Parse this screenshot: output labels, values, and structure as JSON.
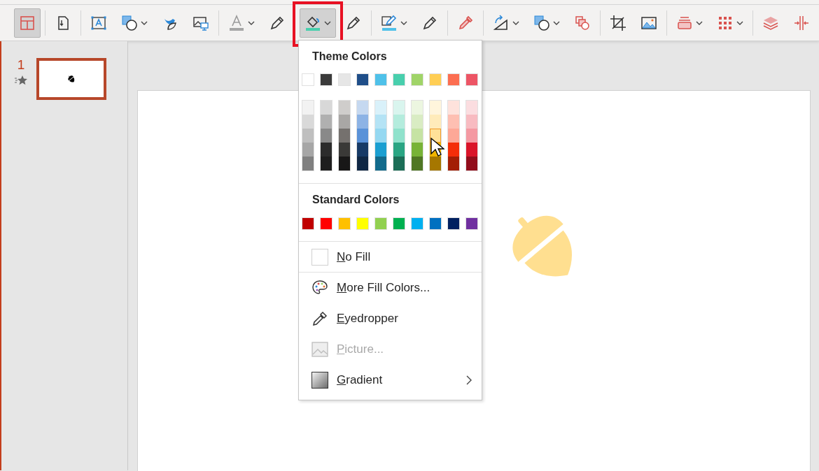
{
  "toolbar": {
    "groups": [
      {
        "buttons": [
          {
            "selected": true,
            "dropdown": false,
            "highlighted": false
          }
        ]
      },
      {
        "buttons": [
          {
            "selected": false,
            "dropdown": false,
            "highlighted": false
          }
        ]
      },
      {
        "buttons": [
          {
            "selected": false,
            "dropdown": false,
            "highlighted": false
          },
          {
            "selected": false,
            "dropdown": true,
            "highlighted": false
          },
          {
            "selected": false,
            "dropdown": false,
            "highlighted": false
          },
          {
            "selected": false,
            "dropdown": false,
            "highlighted": false
          }
        ]
      },
      {
        "buttons": [
          {
            "selected": false,
            "dropdown": true,
            "highlighted": false
          },
          {
            "selected": false,
            "dropdown": false,
            "highlighted": false
          }
        ]
      },
      {
        "buttons": [
          {
            "selected": true,
            "dropdown": true,
            "highlighted": true
          },
          {
            "selected": false,
            "dropdown": false,
            "highlighted": false
          }
        ]
      },
      {
        "buttons": [
          {
            "selected": false,
            "dropdown": true,
            "highlighted": false
          },
          {
            "selected": false,
            "dropdown": false,
            "highlighted": false
          }
        ]
      },
      {
        "buttons": [
          {
            "selected": false,
            "dropdown": false,
            "highlighted": false
          }
        ]
      },
      {
        "buttons": [
          {
            "selected": false,
            "dropdown": true,
            "highlighted": false
          },
          {
            "selected": false,
            "dropdown": true,
            "highlighted": false
          },
          {
            "selected": false,
            "dropdown": false,
            "highlighted": false
          }
        ]
      },
      {
        "buttons": [
          {
            "selected": false,
            "dropdown": false,
            "highlighted": false
          },
          {
            "selected": false,
            "dropdown": false,
            "highlighted": false
          }
        ]
      },
      {
        "buttons": [
          {
            "selected": false,
            "dropdown": true,
            "highlighted": false
          },
          {
            "selected": false,
            "dropdown": true,
            "highlighted": false
          }
        ]
      },
      {
        "buttons": [
          {
            "selected": false,
            "dropdown": false,
            "highlighted": false
          },
          {
            "selected": false,
            "dropdown": false,
            "highlighted": false
          }
        ]
      }
    ]
  },
  "slides_pane": {
    "slides": [
      {
        "number": "1",
        "selected": true,
        "animated": true
      }
    ]
  },
  "fill_menu": {
    "theme_title": "Theme Colors",
    "theme_colors": [
      {
        "color": "#ffffff",
        "shades": [
          {
            "color": "#f2f2f2",
            "selected": false
          },
          {
            "color": "#d9d9d9",
            "selected": false
          },
          {
            "color": "#bfbfbf",
            "selected": false
          },
          {
            "color": "#a6a6a6",
            "selected": false
          },
          {
            "color": "#808080",
            "selected": false
          }
        ]
      },
      {
        "color": "#3b3b3b",
        "shades": [
          {
            "color": "#d8d8d8",
            "selected": false
          },
          {
            "color": "#b0b0b0",
            "selected": false
          },
          {
            "color": "#898989",
            "selected": false
          },
          {
            "color": "#2c2c2c",
            "selected": false
          },
          {
            "color": "#1e1e1e",
            "selected": false
          }
        ]
      },
      {
        "color": "#e6e6e6",
        "shades": [
          {
            "color": "#cfcdcb",
            "selected": false
          },
          {
            "color": "#a9a7a5",
            "selected": false
          },
          {
            "color": "#75716e",
            "selected": false
          },
          {
            "color": "#3a3937",
            "selected": false
          },
          {
            "color": "#181717",
            "selected": false
          }
        ]
      },
      {
        "color": "#1f4e89",
        "shades": [
          {
            "color": "#c5d8f0",
            "selected": false
          },
          {
            "color": "#8db3e5",
            "selected": false
          },
          {
            "color": "#5a92d8",
            "selected": false
          },
          {
            "color": "#173a66",
            "selected": false
          },
          {
            "color": "#0f2744",
            "selected": false
          }
        ]
      },
      {
        "color": "#4fc1e9",
        "shades": [
          {
            "color": "#d9f1fa",
            "selected": false
          },
          {
            "color": "#b4e3f5",
            "selected": false
          },
          {
            "color": "#95d8f1",
            "selected": false
          },
          {
            "color": "#1b9fd1",
            "selected": false
          },
          {
            "color": "#126b8c",
            "selected": false
          }
        ]
      },
      {
        "color": "#48cfad",
        "shades": [
          {
            "color": "#d9f5ee",
            "selected": false
          },
          {
            "color": "#b4ecdd",
            "selected": false
          },
          {
            "color": "#90e2cc",
            "selected": false
          },
          {
            "color": "#2aa583",
            "selected": false
          },
          {
            "color": "#1c6e57",
            "selected": false
          }
        ]
      },
      {
        "color": "#a0d468",
        "shades": [
          {
            "color": "#ecf6e0",
            "selected": false
          },
          {
            "color": "#d9ecc3",
            "selected": false
          },
          {
            "color": "#c6e3a4",
            "selected": false
          },
          {
            "color": "#78b337",
            "selected": false
          },
          {
            "color": "#507724",
            "selected": false
          }
        ]
      },
      {
        "color": "#ffce54",
        "shades": [
          {
            "color": "#fff5dc",
            "selected": false
          },
          {
            "color": "#ffebba",
            "selected": false
          },
          {
            "color": "#ffe198",
            "selected": true
          },
          {
            "color": "#f0b400",
            "selected": false
          },
          {
            "color": "#a67700",
            "selected": false
          }
        ]
      },
      {
        "color": "#fc6e51",
        "shades": [
          {
            "color": "#fee2dc",
            "selected": false
          },
          {
            "color": "#febfb2",
            "selected": false
          },
          {
            "color": "#fda897",
            "selected": false
          },
          {
            "color": "#f42e09",
            "selected": false
          },
          {
            "color": "#a31e05",
            "selected": false
          }
        ]
      },
      {
        "color": "#ed5565",
        "shades": [
          {
            "color": "#fbdde0",
            "selected": false
          },
          {
            "color": "#f8bbc1",
            "selected": false
          },
          {
            "color": "#f499a2",
            "selected": false
          },
          {
            "color": "#da1429",
            "selected": false
          },
          {
            "color": "#920d1b",
            "selected": false
          }
        ]
      }
    ],
    "standard_title": "Standard Colors",
    "standard_colors": [
      {
        "color": "#c00000"
      },
      {
        "color": "#ff0000"
      },
      {
        "color": "#ffc000"
      },
      {
        "color": "#ffff00"
      },
      {
        "color": "#92d050"
      },
      {
        "color": "#00b050"
      },
      {
        "color": "#00b0f0"
      },
      {
        "color": "#0070c0"
      },
      {
        "color": "#002060"
      },
      {
        "color": "#7030a0"
      }
    ],
    "items": [
      {
        "kind": "no-fill",
        "label": "No Fill",
        "disabled": false,
        "submenu": false
      },
      {
        "kind": "palette",
        "label": "More Fill Colors...",
        "disabled": false,
        "submenu": false
      },
      {
        "kind": "eyedropper",
        "label": "Eyedropper",
        "disabled": false,
        "submenu": false
      },
      {
        "kind": "picture",
        "label": "Picture...",
        "disabled": true,
        "submenu": false
      },
      {
        "kind": "gradient",
        "label": "Gradient",
        "disabled": false,
        "submenu": true
      }
    ]
  }
}
